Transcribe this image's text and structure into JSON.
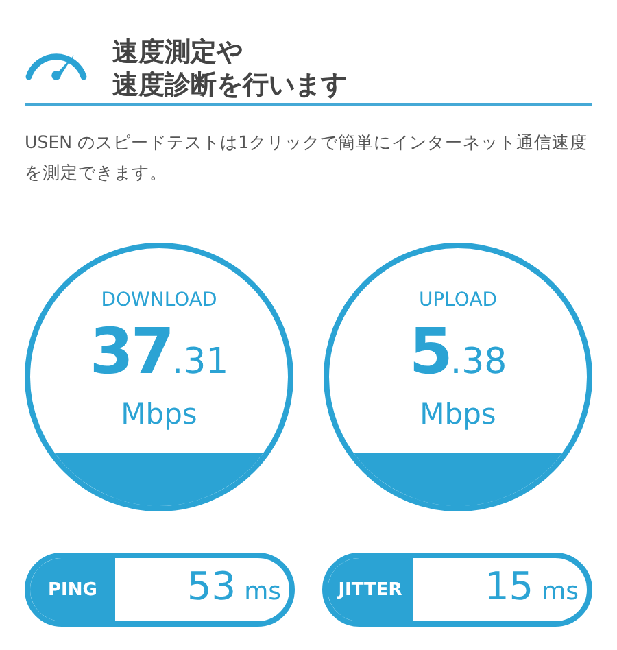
{
  "header": {
    "title_lines": [
      "速度測定や",
      "速度診断を行います"
    ]
  },
  "description": "USEN のスピードテストは1クリックで簡単にインターネット通信速度を測定できます。",
  "gauges": [
    {
      "label": "DOWNLOAD",
      "value_whole": "37",
      "value_fraction": ".31",
      "unit": "Mbps"
    },
    {
      "label": "UPLOAD",
      "value_whole": "5",
      "value_fraction": ".38",
      "unit": "Mbps"
    }
  ],
  "stats": [
    {
      "label": "PING",
      "value": "53",
      "unit": "ms"
    },
    {
      "label": "JITTER",
      "value": "15",
      "unit": "ms"
    }
  ]
}
